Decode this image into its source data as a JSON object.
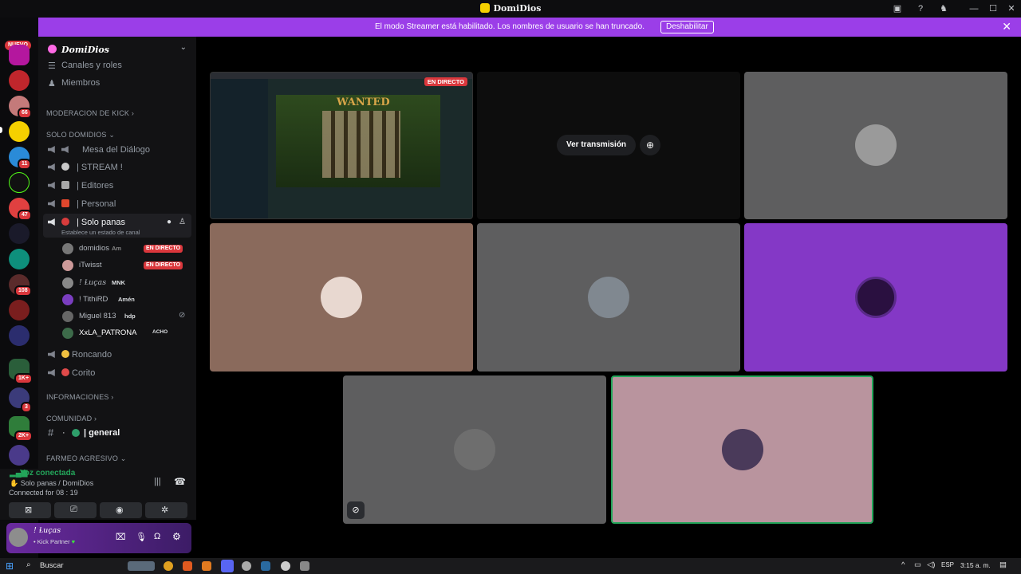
{
  "titlebar": {
    "app_name": "DomiDios"
  },
  "banner": {
    "message": "El modo Streamer está habilitado. Los nombres de usuario se han truncado.",
    "button_label": "Deshabilitar"
  },
  "rail": {
    "nuevo_label": "NUEVO",
    "badges": [
      "66",
      "11",
      "47",
      "108",
      "1K+",
      "3",
      "2K+"
    ]
  },
  "guild": {
    "name": "DomiDios"
  },
  "nav": {
    "channels_roles": "Canales y roles",
    "members": "Miembros"
  },
  "categories": {
    "moderacion": "MODERACION DE KICK",
    "solo": "SOLO DOMIDIOS",
    "info": "INFORMACIONES",
    "comunidad": "COMUNIDAD",
    "farmeo": "FARMEO AGRESIVO"
  },
  "channels": {
    "mesa": "Mesa del Diálogo",
    "stream": "| STREAM !",
    "editores": "| Editores",
    "personal": "| Personal",
    "solo_panas": "| Solo panas",
    "solo_panas_status": "Establece un estado de canal",
    "roncando": "Roncando",
    "corito": "Corito",
    "general": "| general"
  },
  "members": [
    {
      "name": "domidios",
      "tag": "Am",
      "live": "EN DIRECTO"
    },
    {
      "name": "iTwisst",
      "tag": "",
      "live": "EN DIRECTO"
    },
    {
      "name": "! Ɫuças",
      "tag": "MNK",
      "live": ""
    },
    {
      "name": "! TithiRD",
      "tag": "Amén",
      "live": ""
    },
    {
      "name": "Miguel 813",
      "tag": "hdp",
      "live": ""
    },
    {
      "name": "XxLA_PATRONA",
      "tag": "ACHO",
      "live": ""
    }
  ],
  "voice": {
    "status": "Voz conectada",
    "channel": "Solo panas / DomiDios",
    "connected_label": "Connected for",
    "timer": "08 : 19"
  },
  "user": {
    "name": "! Ɫuças",
    "subtitle": "Kick Partner"
  },
  "stage": {
    "live_badge": "EN DIRECTO",
    "watch_button": "Ver transmisión",
    "stream_title": "WANTED"
  },
  "taskbar": {
    "search_placeholder": "Buscar",
    "lang": "ESP",
    "time": "3:15 a. m."
  },
  "colors": {
    "accent": "#9b3ee8",
    "live": "#da373c",
    "tile_brown": "#8a6a5c",
    "tile_gray": "#5e5e5f",
    "tile_purple": "#8438c6",
    "tile_pink": "#b9949e"
  }
}
